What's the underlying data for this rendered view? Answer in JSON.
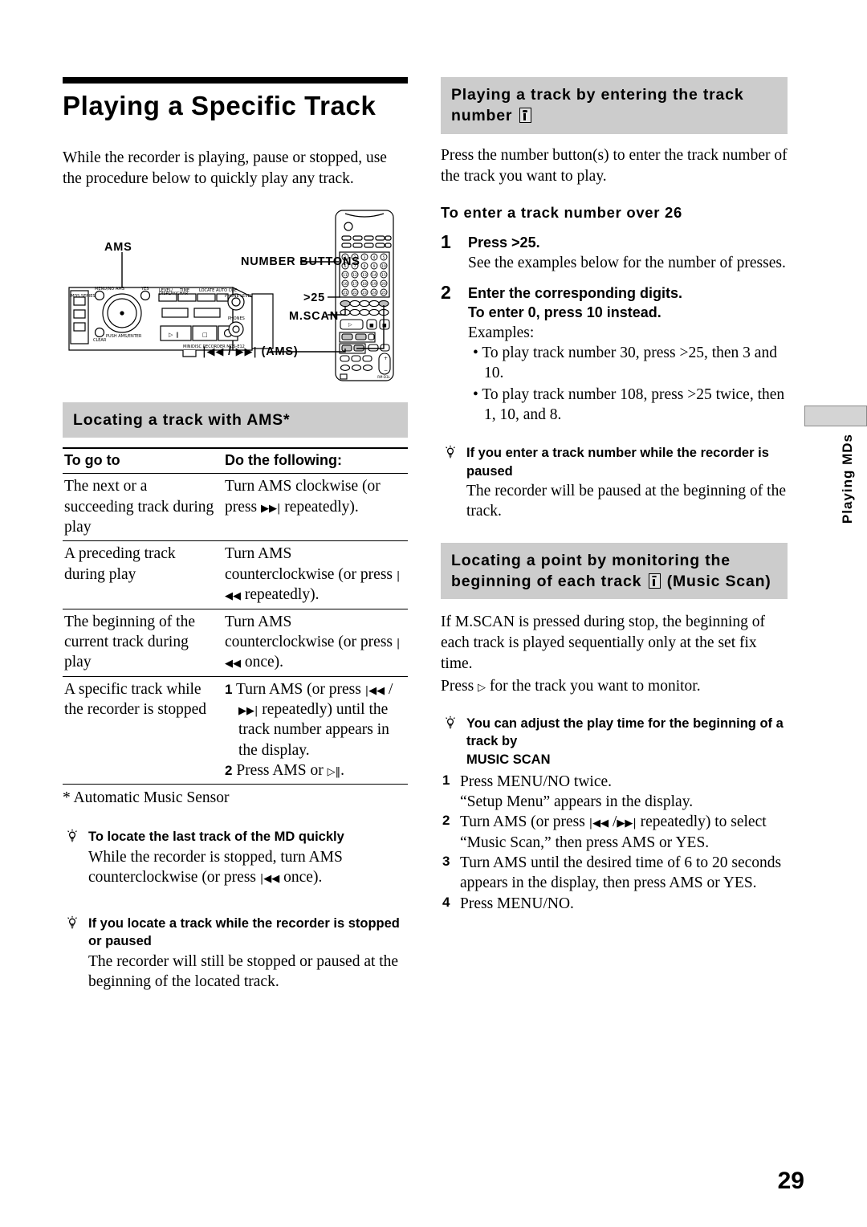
{
  "page": {
    "number": "29",
    "edge_tab_label": "Playing MDs"
  },
  "left": {
    "title": "Playing a Specific Track",
    "intro": "While the recorder is playing, pause or stopped, use the procedure below to quickly play any track.",
    "figure": {
      "labels": {
        "ams": "AMS",
        "number_buttons": "NUMBER BUTTONS",
        "gt25": ">25",
        "mscan": "M.SCAN",
        "prev_next_ams": "(AMS)"
      },
      "deck_model_text": "MINIDISC RECORDER MDS-E12",
      "number_button_values": [
        "1",
        "2",
        "3",
        "4",
        "5",
        "6",
        "7",
        "8",
        "9",
        "10",
        "11",
        "12",
        "13",
        "14",
        "15",
        "16",
        "17",
        "18",
        "19",
        "20",
        "21",
        "22",
        "23",
        "24",
        "25"
      ]
    },
    "ams_section": {
      "band_title": "Locating a track with AMS*",
      "columns": [
        "To go to",
        "Do the following:"
      ],
      "rows": [
        {
          "go_to": "The next or a succeeding track during play",
          "do": "Turn AMS clockwise (or press ▶▶| repeatedly)."
        },
        {
          "go_to": "A preceding track during play",
          "do": "Turn AMS counterclockwise (or press |◀◀ repeatedly)."
        },
        {
          "go_to": "The beginning of the current track during play",
          "do": "Turn AMS counterclockwise (or press |◀◀ once)."
        },
        {
          "go_to": "A specific track while the recorder is stopped",
          "do_steps": [
            {
              "num": "1",
              "text": "Turn AMS (or press |◀◀ / ▶▶| repeatedly) until the track number appears in the display."
            },
            {
              "num": "2",
              "text": "Press AMS or ▷‖."
            }
          ]
        }
      ],
      "footnote": "* Automatic Music Sensor"
    },
    "tips": [
      {
        "head": "To locate the last track of the MD quickly",
        "body": "While the recorder is stopped, turn AMS counterclockwise (or press |◀◀ once)."
      },
      {
        "head": "If you locate a track while the recorder is stopped or paused",
        "body": "The recorder will still be stopped or paused at the beginning of the located track."
      }
    ]
  },
  "right": {
    "band1_line1": "Playing a track by entering the track",
    "band1_line2": "number",
    "intro": "Press the number button(s) to enter the track number of the track you want to play.",
    "sub_head": "To enter a track number over 26",
    "steps": [
      {
        "num": "1",
        "strong": "Press >25.",
        "text": "See the examples below for the number of presses."
      },
      {
        "num": "2",
        "strong_line1": "Enter the corresponding digits.",
        "strong_line2": "To enter 0, press 10 instead.",
        "text": "Examples:",
        "examples": [
          "To play track number 30, press >25, then 3 and 10.",
          "To play track number 108, press >25 twice, then 1, 10, and 8."
        ]
      }
    ],
    "tip_paused": {
      "head": "If you enter a track number while the recorder is paused",
      "body": "The recorder will be paused at the beginning of the track."
    },
    "band2_line1": "Locating a point by monitoring the",
    "band2_line2_pre": "beginning of each track",
    "band2_line2_post": "(Music Scan)",
    "mscan_intro_1": "If M.SCAN is pressed during stop, the beginning of each track is played sequentially only at the set fix time.",
    "mscan_intro_2_pre": "Press",
    "mscan_intro_2_post": "for the track you want to monitor.",
    "tip_mscan": {
      "head_line1": "You can adjust the play time for the beginning of a track by",
      "head_line2": "MUSIC SCAN",
      "steps": [
        {
          "num": "1",
          "text": "Press MENU/NO twice."
        },
        {
          "num": "",
          "text": "“Setup Menu” appears in the display."
        },
        {
          "num": "2",
          "text": "Turn AMS (or press |◀◀ /▶▶| repeatedly) to select"
        },
        {
          "num": "",
          "text": "“Music Scan,” then press AMS or YES."
        },
        {
          "num": "3",
          "text": "Turn AMS until the desired time of 6 to 20 seconds"
        },
        {
          "num": "",
          "text": "appears in the display, then press AMS or YES."
        },
        {
          "num": "4",
          "text": "Press MENU/NO."
        }
      ]
    }
  },
  "colors": {
    "band_gray": "#cccccc",
    "tab_gray": "#d4d4d4",
    "rule_black": "#000000"
  }
}
